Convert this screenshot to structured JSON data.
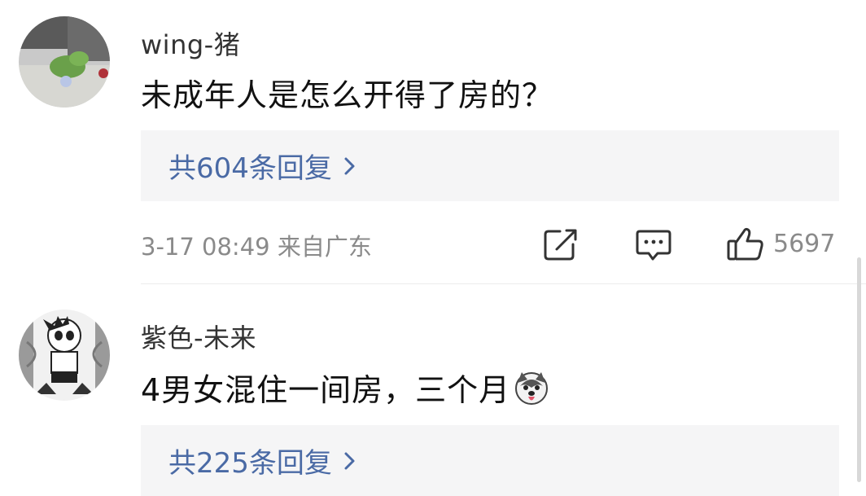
{
  "comments": [
    {
      "username": "wing-猪",
      "text": "未成年人是怎么开得了房的？",
      "replies_label": "共604条回复",
      "meta": "3-17 08:49  来自广东",
      "likes": "5697",
      "avatar_icon": "hydrangea-photo-avatar"
    },
    {
      "username": "紫色-未来",
      "text": "4男女混住一间房，三个月",
      "emoji_icon": "husky-dog-emoji",
      "replies_label": "共225条回复",
      "avatar_icon": "astro-boy-avatar"
    }
  ],
  "colors": {
    "link_blue": "#4a6aa5",
    "meta_gray": "#8a8a8a",
    "reply_bg": "#f5f5f6"
  }
}
